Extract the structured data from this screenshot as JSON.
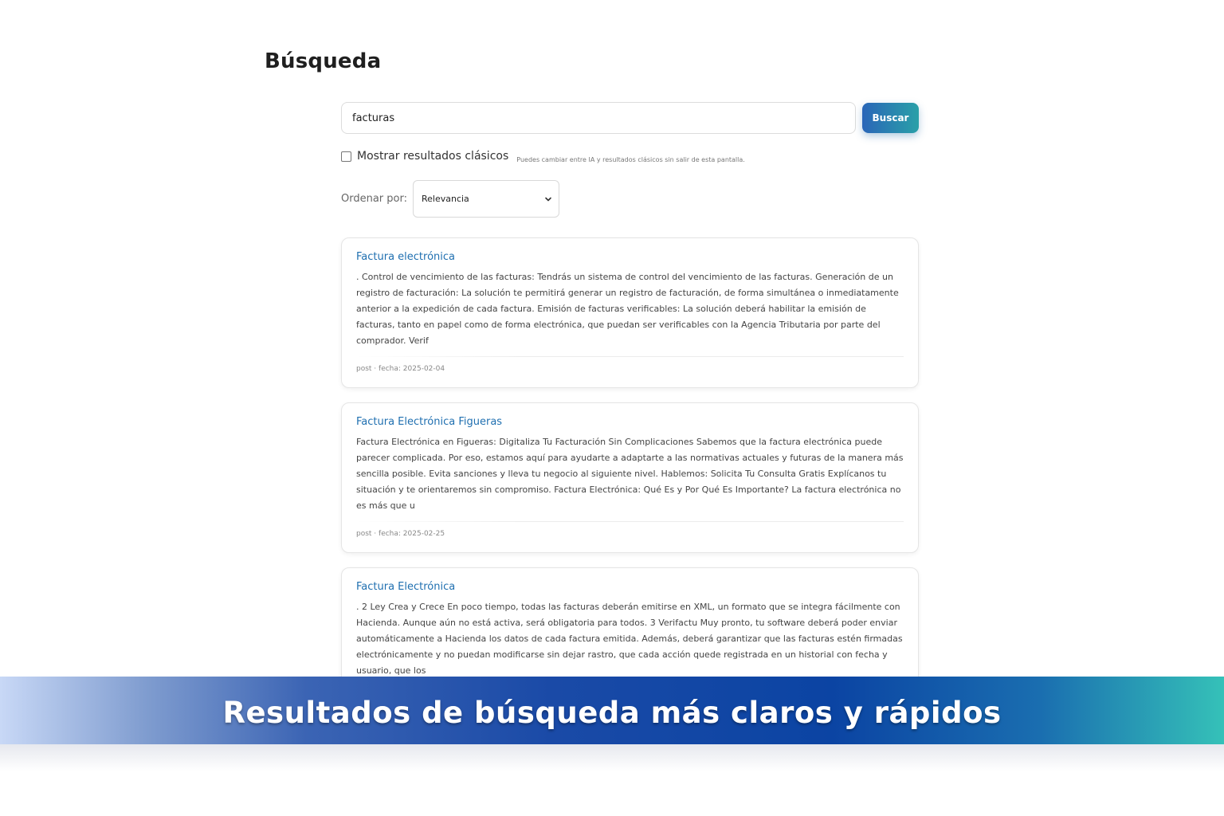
{
  "page": {
    "title": "Búsqueda"
  },
  "search": {
    "value": "facturas",
    "button_label": "Buscar"
  },
  "classic_toggle": {
    "label": "Mostrar resultados clásicos",
    "hint": "Puedes cambiar entre IA y resultados clásicos sin salir de esta pantalla.",
    "checked": false
  },
  "sort": {
    "label": "Ordenar por:",
    "selected": "Relevancia"
  },
  "results": [
    {
      "title": "Factura electrónica",
      "snippet": ". Control de vencimiento de las facturas: Tendrás un sistema de control del vencimiento de las facturas. Generación de un registro de facturación: La solución te permitirá generar un registro de facturación, de forma simultánea o inmediatamente anterior a la expedición de cada factura. Emisión de facturas verificables: La solución deberá habilitar la emisión de facturas, tanto en papel como de forma electrónica, que puedan ser verificables con la Agencia Tributaria por parte del comprador. Verif",
      "meta": "post · fecha: 2025-02-04"
    },
    {
      "title": "Factura Electrónica Figueras",
      "snippet": "Factura Electrónica en Figueras: Digitaliza Tu Facturación Sin Complicaciones Sabemos que la factura electrónica puede parecer complicada. Por eso, estamos aquí para ayudarte a adaptarte a las normativas actuales y futuras de la manera más sencilla posible. Evita sanciones y lleva tu negocio al siguiente nivel. Hablemos: Solicita Tu Consulta Gratis Explícanos tu situación y te orientaremos sin compromiso. Factura Electrónica: Qué Es y Por Qué Es Importante? La factura electrónica no es más que u",
      "meta": "post · fecha: 2025-02-25"
    },
    {
      "title": "Factura Electrónica",
      "snippet": ". 2 Ley Crea y Crece En poco tiempo, todas las facturas deberán emitirse en XML, un formato que se integra fácilmente con Hacienda. Aunque aún no está activa, será obligatoria para todos. 3 Verifactu Muy pronto, tu software deberá poder enviar automáticamente a Hacienda los datos de cada factura emitida. Además, deberá garantizar que las facturas estén firmadas electrónicamente y no puedan modificarse sin dejar rastro, que cada acción quede registrada en un historial con fecha y usuario, que los",
      "meta": ""
    }
  ],
  "banner": {
    "text": "Resultados de búsqueda más claros y rápidos"
  },
  "colors": {
    "link": "#1f6fb0",
    "button_gradient_start": "#2a66b8",
    "button_gradient_end": "#2aa0a8",
    "banner_gradient_left": "#c8d8f6",
    "banner_gradient_mid": "#0b44a3",
    "banner_gradient_right": "#35c1b8"
  },
  "icons": {
    "select_chevron": "chevron-down-icon"
  }
}
